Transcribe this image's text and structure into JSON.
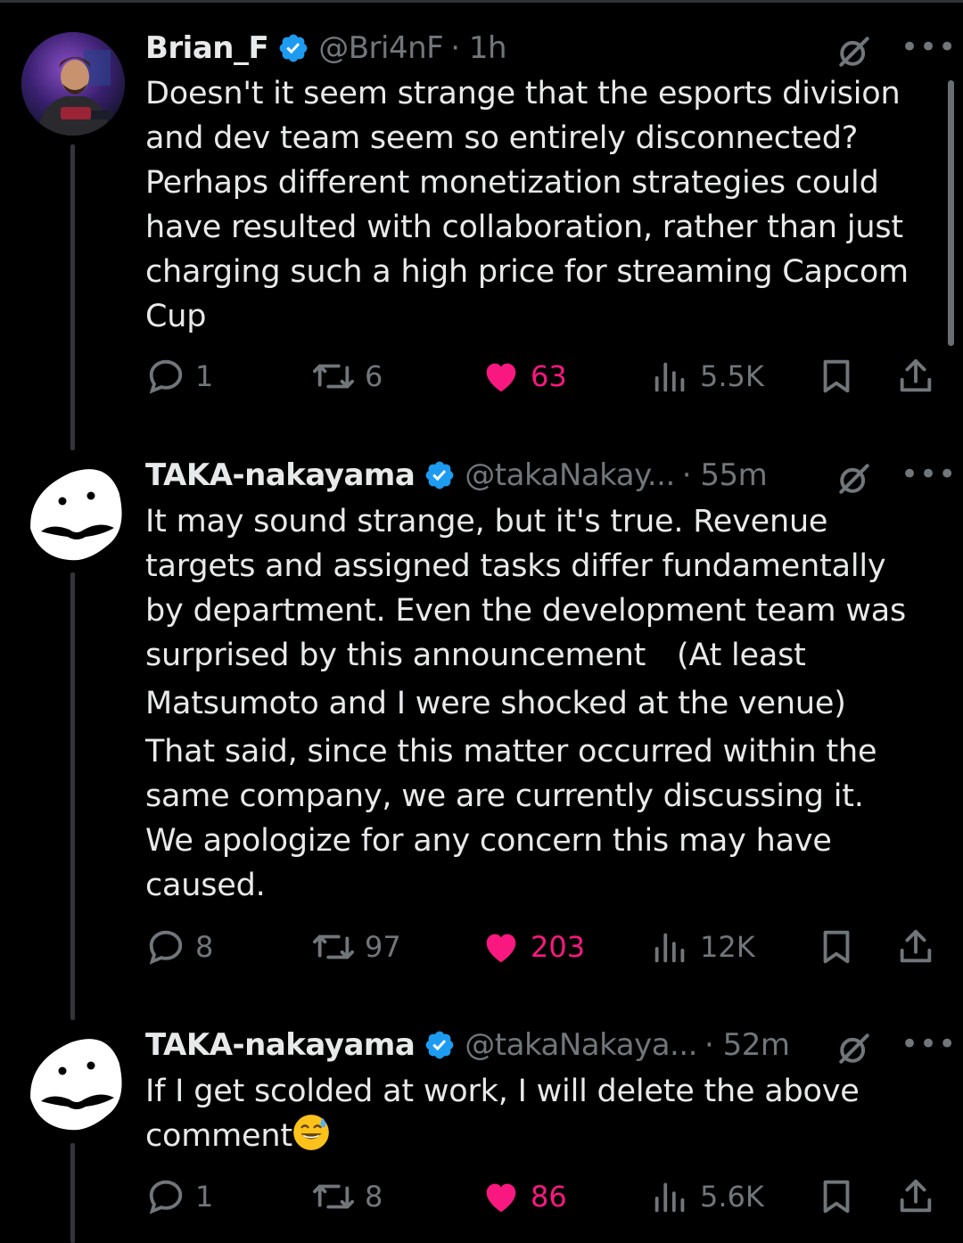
{
  "tweets": [
    {
      "name": "Brian_F",
      "handle": "@Bri4nF",
      "time": "· 1h",
      "lines": [
        "Doesn't it seem strange that the esports division",
        "and dev team seem so entirely disconnected?",
        "Perhaps different monetization strategies could",
        "have resulted with collaboration, rather than just",
        "charging such a high price for streaming Capcom",
        "Cup"
      ],
      "replies": "1",
      "reposts": "6",
      "likes": "63",
      "views": "5.5K"
    },
    {
      "name": "TAKA-nakayama",
      "handle": "@takaNakay...",
      "time": "· 55m",
      "lines": [
        "It may sound strange, but it's true. Revenue",
        "targets and assigned tasks differ fundamentally",
        "by department. Even the development team was",
        "surprised by this announcement　(At least",
        "Matsumoto and I were shocked at the venue)",
        "That said, since this matter occurred within the",
        "same company, we are currently discussing it.",
        "We apologize for any concern this may have",
        "caused."
      ],
      "replies": "8",
      "reposts": "97",
      "likes": "203",
      "views": "12K"
    },
    {
      "name": "TAKA-nakayama",
      "handle": "@takaNakaya...",
      "time": "· 52m",
      "lines": [
        "If I get scolded at work, I will delete the above",
        "comment"
      ],
      "replies": "1",
      "reposts": "8",
      "likes": "86",
      "views": "5.6K"
    }
  ],
  "icons": {
    "verified": "verified-badge-icon",
    "grok": "grok-icon",
    "more": "more-icon",
    "reply": "reply-icon",
    "repost": "repost-icon",
    "like": "heart-icon",
    "views": "views-icon",
    "bookmark": "bookmark-icon",
    "share": "share-icon",
    "emoji": "grinning-sweat-emoji"
  },
  "colors": {
    "background": "#000000",
    "text": "#e7e9ea",
    "secondary": "#71767b",
    "like": "#f91880",
    "verified": "#1d9bf0"
  }
}
